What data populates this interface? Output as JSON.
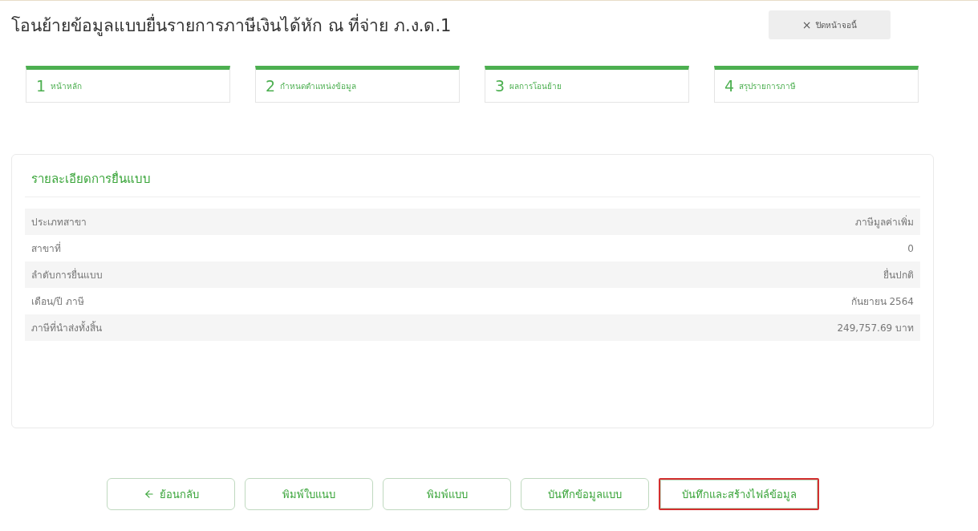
{
  "title": "โอนย้ายข้อมูลแบบยื่นรายการภาษีเงินได้หัก ณ ที่จ่าย ภ.ง.ด.1",
  "close_button": {
    "icon": "×",
    "label": "ปิดหน้าจอนี้"
  },
  "steps": [
    {
      "number": "1",
      "label": "หน้าหลัก"
    },
    {
      "number": "2",
      "label": "กำหนดตำแหน่งข้อมูล"
    },
    {
      "number": "3",
      "label": "ผลการโอนย้าย"
    },
    {
      "number": "4",
      "label": "สรุปรายการภาษี"
    }
  ],
  "details": {
    "heading": "รายละเอียดการยื่นแบบ",
    "rows": [
      {
        "label": "ประเภทสาขา",
        "value": "ภาษีมูลค่าเพิ่ม"
      },
      {
        "label": "สาขาที่",
        "value": "0"
      },
      {
        "label": "ลำดับการยื่นแบบ",
        "value": "ยื่นปกติ"
      },
      {
        "label": "เดือน/ปี ภาษี",
        "value": "กันยายน 2564"
      },
      {
        "label": "ภาษีที่นำส่งทั้งสิ้น",
        "value": "249,757.69 บาท"
      }
    ]
  },
  "buttons": [
    {
      "kind": "back",
      "label": "ย้อนกลับ",
      "highlighted": false
    },
    {
      "kind": "plain",
      "label": "พิมพ์ใบแนบ",
      "highlighted": false
    },
    {
      "kind": "plain",
      "label": "พิมพ์แบบ",
      "highlighted": false
    },
    {
      "kind": "plain",
      "label": "บันทึกข้อมูลแบบ",
      "highlighted": false
    },
    {
      "kind": "plain",
      "label": "บันทึกและสร้างไฟล์ข้อมูล",
      "highlighted": true
    }
  ]
}
